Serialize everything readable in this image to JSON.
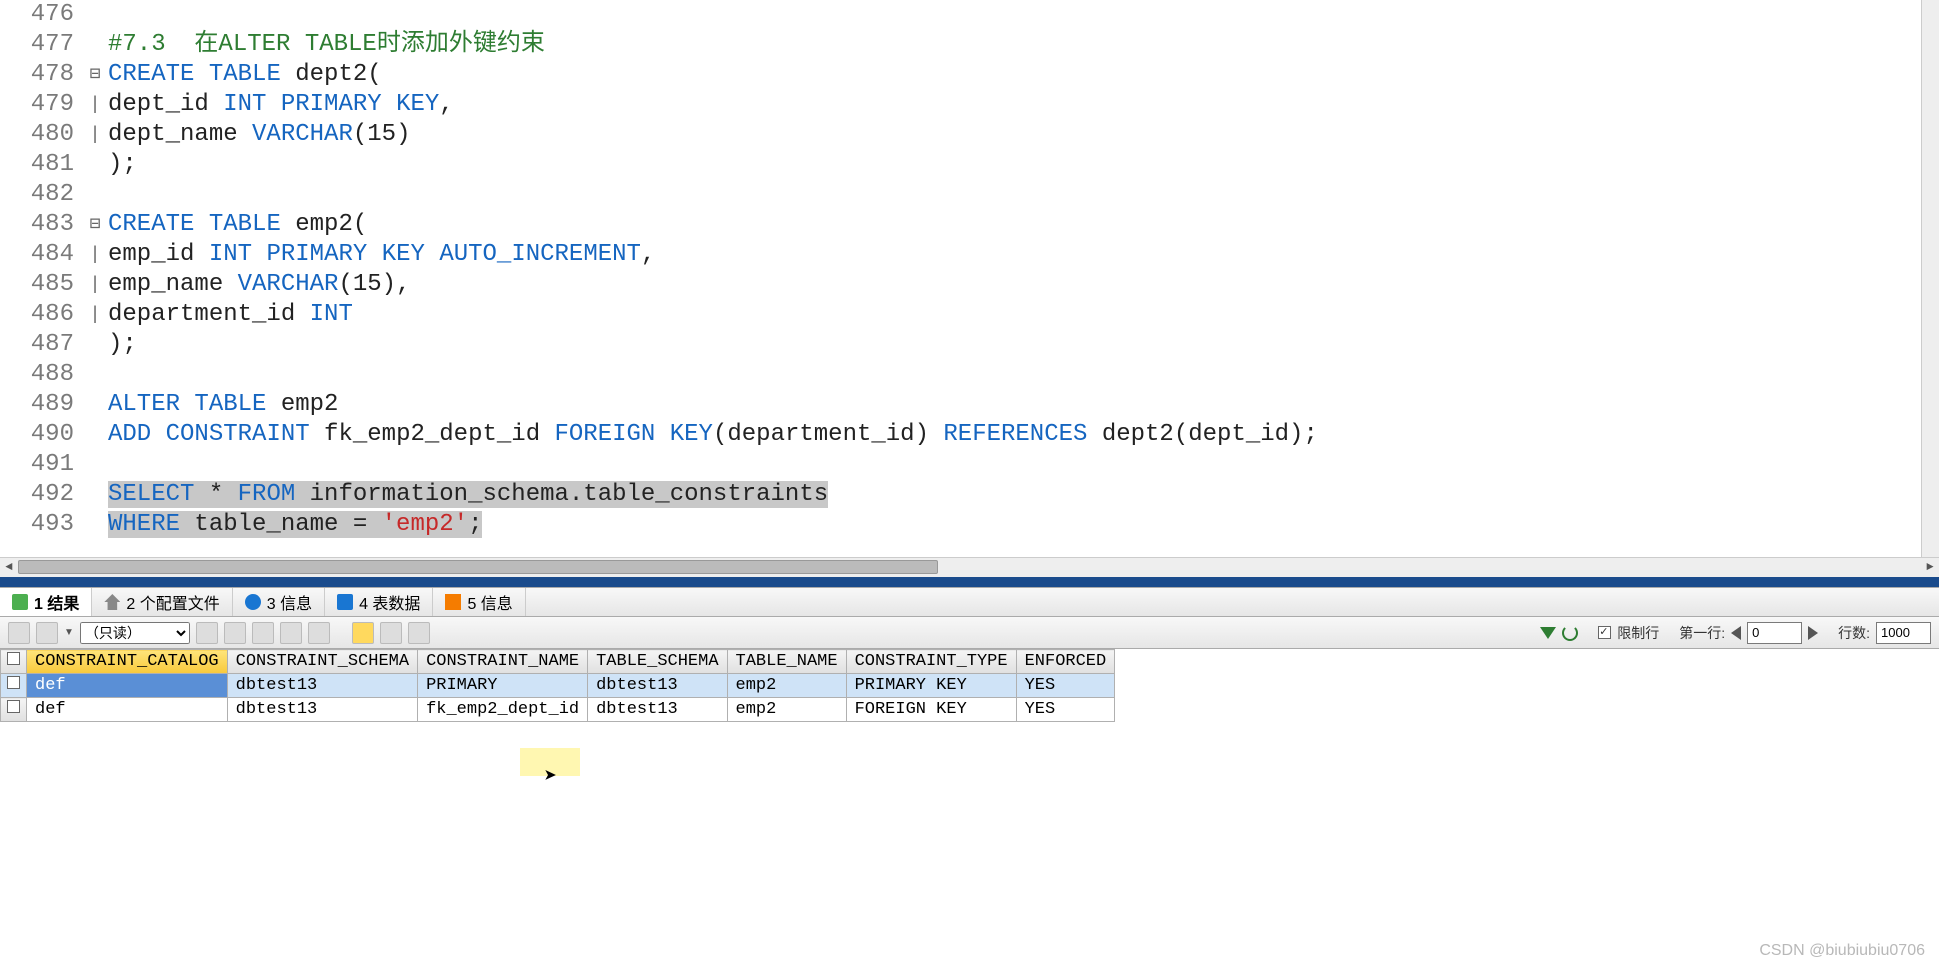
{
  "editor": {
    "lines": [
      {
        "num": "476",
        "fold": "",
        "html": ""
      },
      {
        "num": "477",
        "fold": "",
        "html": "<span class='cmt'>#7.3  在ALTER TABLE时添加外键约束</span>"
      },
      {
        "num": "478",
        "fold": "⊟",
        "html": "<span class='kw'>CREATE</span> <span class='kw'>TABLE</span> dept2("
      },
      {
        "num": "479",
        "fold": "|",
        "html": "dept_id <span class='kw'>INT</span> <span class='kw'>PRIMARY</span> <span class='kw'>KEY</span>,"
      },
      {
        "num": "480",
        "fold": "|",
        "html": "dept_name <span class='kw'>VARCHAR</span>(15)"
      },
      {
        "num": "481",
        "fold": "",
        "html": ");"
      },
      {
        "num": "482",
        "fold": "",
        "html": ""
      },
      {
        "num": "483",
        "fold": "⊟",
        "html": "<span class='kw'>CREATE</span> <span class='kw'>TABLE</span> emp2("
      },
      {
        "num": "484",
        "fold": "|",
        "html": "emp_id <span class='kw'>INT</span> <span class='kw'>PRIMARY</span> <span class='kw'>KEY</span> <span class='kw'>AUTO_INCREMENT</span>,"
      },
      {
        "num": "485",
        "fold": "|",
        "html": "emp_name <span class='kw'>VARCHAR</span>(15),"
      },
      {
        "num": "486",
        "fold": "|",
        "html": "department_id <span class='kw'>INT</span>"
      },
      {
        "num": "487",
        "fold": "",
        "html": ");"
      },
      {
        "num": "488",
        "fold": "",
        "html": ""
      },
      {
        "num": "489",
        "fold": "",
        "html": "<span class='kw'>ALTER</span> <span class='kw'>TABLE</span> emp2"
      },
      {
        "num": "490",
        "fold": "",
        "html": "<span class='kw'>ADD</span> <span class='kw'>CONSTRAINT</span> fk_emp2_dept_id <span class='kw'>FOREIGN</span> <span class='kw'>KEY</span>(department_id) <span class='kw'>REFERENCES</span> dept2(dept_id);"
      },
      {
        "num": "491",
        "fold": "",
        "html": ""
      },
      {
        "num": "492",
        "fold": "",
        "html": "<span class='sel'><span class='kw'>SELECT</span> * <span class='kw'>FROM</span> information_schema.table_constraints</span>"
      },
      {
        "num": "493",
        "fold": "",
        "html": "<span class='sel'><span class='kw'>WHERE</span> table_name = <span class='str'>'emp2'</span>;</span>"
      }
    ]
  },
  "tabs": [
    {
      "icon": "ic-doc",
      "label": "1 结果",
      "active": true
    },
    {
      "icon": "ic-home",
      "label": "2 个配置文件",
      "active": false
    },
    {
      "icon": "ic-info",
      "label": "3 信息",
      "active": false
    },
    {
      "icon": "ic-grid",
      "label": "4 表数据",
      "active": false
    },
    {
      "icon": "ic-flag",
      "label": "5 信息",
      "active": false
    }
  ],
  "toolbar2": {
    "readonly_option": "（只读）",
    "limit_row_label": "限制行",
    "limit_row_checked": true,
    "first_row_label": "第一行:",
    "first_row_value": "0",
    "row_count_label": "行数:",
    "row_count_value": "1000"
  },
  "grid": {
    "columns": [
      "CONSTRAINT_CATALOG",
      "CONSTRAINT_SCHEMA",
      "CONSTRAINT_NAME",
      "TABLE_SCHEMA",
      "TABLE_NAME",
      "CONSTRAINT_TYPE",
      "ENFORCED"
    ],
    "rows": [
      {
        "selected": true,
        "cells": [
          "def",
          "dbtest13",
          "PRIMARY",
          "dbtest13",
          "emp2",
          "PRIMARY KEY",
          "YES"
        ]
      },
      {
        "selected": false,
        "cells": [
          "def",
          "dbtest13",
          "fk_emp2_dept_id",
          "dbtest13",
          "emp2",
          "FOREIGN KEY",
          "YES"
        ]
      }
    ]
  },
  "watermark": "CSDN @biubiubiu0706"
}
